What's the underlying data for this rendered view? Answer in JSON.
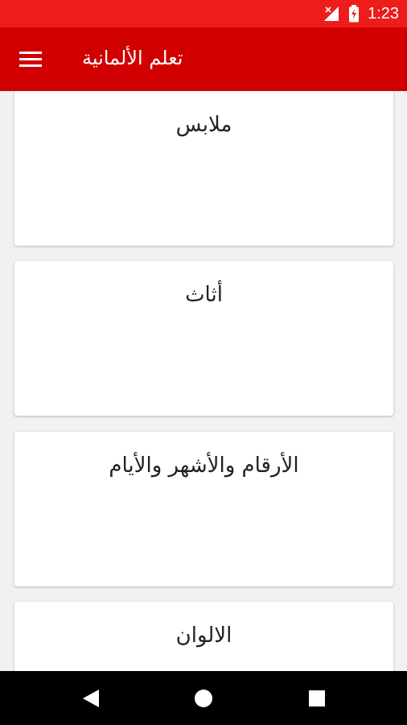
{
  "status_bar": {
    "time": "1:23"
  },
  "app_bar": {
    "title": "تعلم الألمانية"
  },
  "categories": [
    {
      "label": "ملابس"
    },
    {
      "label": "أثاث"
    },
    {
      "label": "الأرقام والأشهر والأيام"
    },
    {
      "label": "الالوان"
    }
  ],
  "colors": {
    "status_bar": "#ef1c1c",
    "app_bar": "#d10000",
    "background": "#f1f1f1",
    "card": "#ffffff"
  },
  "icons": {
    "menu": "hamburger-menu-icon",
    "back": "back-triangle-icon",
    "home": "home-circle-icon",
    "recents": "recents-square-icon"
  }
}
